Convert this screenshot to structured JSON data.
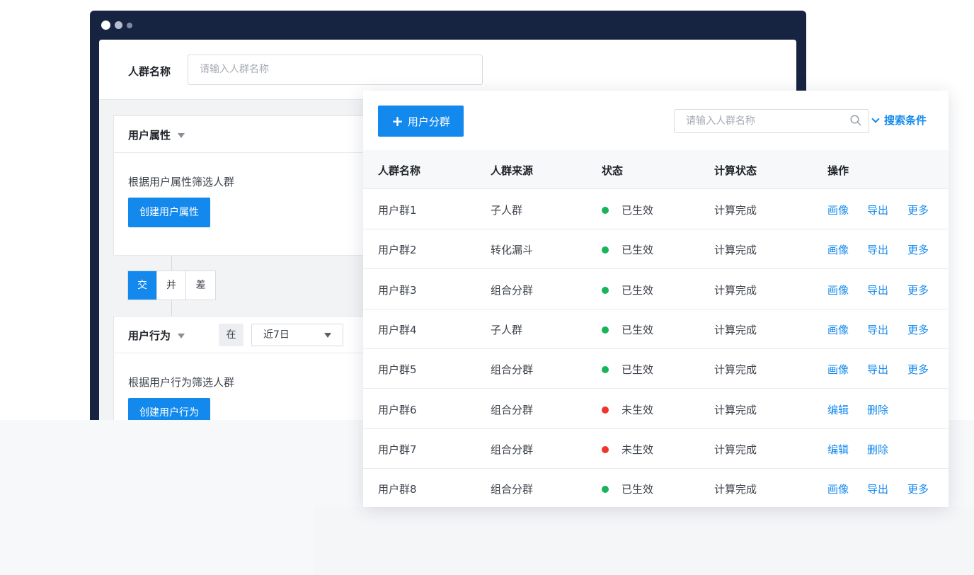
{
  "back": {
    "name_label": "人群名称",
    "name_placeholder": "请输入人群名称",
    "attr_card": {
      "title": "用户属性",
      "desc": "根据用户属性筛选人群",
      "button": "创建用户属性"
    },
    "ops": [
      "交",
      "并",
      "差"
    ],
    "behavior_card": {
      "title": "用户行为",
      "zai": "在",
      "period": "近7日",
      "desc": "根据用户行为筛选人群",
      "button": "创建用户行为"
    }
  },
  "front": {
    "add_button": "用户分群",
    "search_placeholder": "请输入人群名称",
    "conditions": "搜索条件",
    "columns": [
      "人群名称",
      "人群来源",
      "状态",
      "计算状态",
      "操作"
    ],
    "rows": [
      {
        "name": "用户群1",
        "source": "子人群",
        "status": "已生效",
        "calc": "计算完成",
        "ops": [
          "画像",
          "导出",
          "更多"
        ]
      },
      {
        "name": "用户群2",
        "source": "转化漏斗",
        "status": "已生效",
        "calc": "计算完成",
        "ops": [
          "画像",
          "导出",
          "更多"
        ]
      },
      {
        "name": "用户群3",
        "source": "组合分群",
        "status": "已生效",
        "calc": "计算完成",
        "ops": [
          "画像",
          "导出",
          "更多"
        ]
      },
      {
        "name": "用户群4",
        "source": "子人群",
        "status": "已生效",
        "calc": "计算完成",
        "ops": [
          "画像",
          "导出",
          "更多"
        ]
      },
      {
        "name": "用户群5",
        "source": "组合分群",
        "status": "已生效",
        "calc": "计算完成",
        "ops": [
          "画像",
          "导出",
          "更多"
        ]
      },
      {
        "name": "用户群6",
        "source": "组合分群",
        "status": "未生效",
        "calc": "计算完成",
        "ops": [
          "编辑",
          "删除"
        ]
      },
      {
        "name": "用户群7",
        "source": "组合分群",
        "status": "未生效",
        "calc": "计算完成",
        "ops": [
          "编辑",
          "删除"
        ]
      },
      {
        "name": "用户群8",
        "source": "组合分群",
        "status": "已生效",
        "calc": "计算完成",
        "ops": [
          "画像",
          "导出",
          "更多"
        ]
      }
    ]
  },
  "colors": {
    "accent": "#1389ee",
    "active": "#19b35a",
    "inactive": "#f0362b",
    "window": "#172441"
  }
}
